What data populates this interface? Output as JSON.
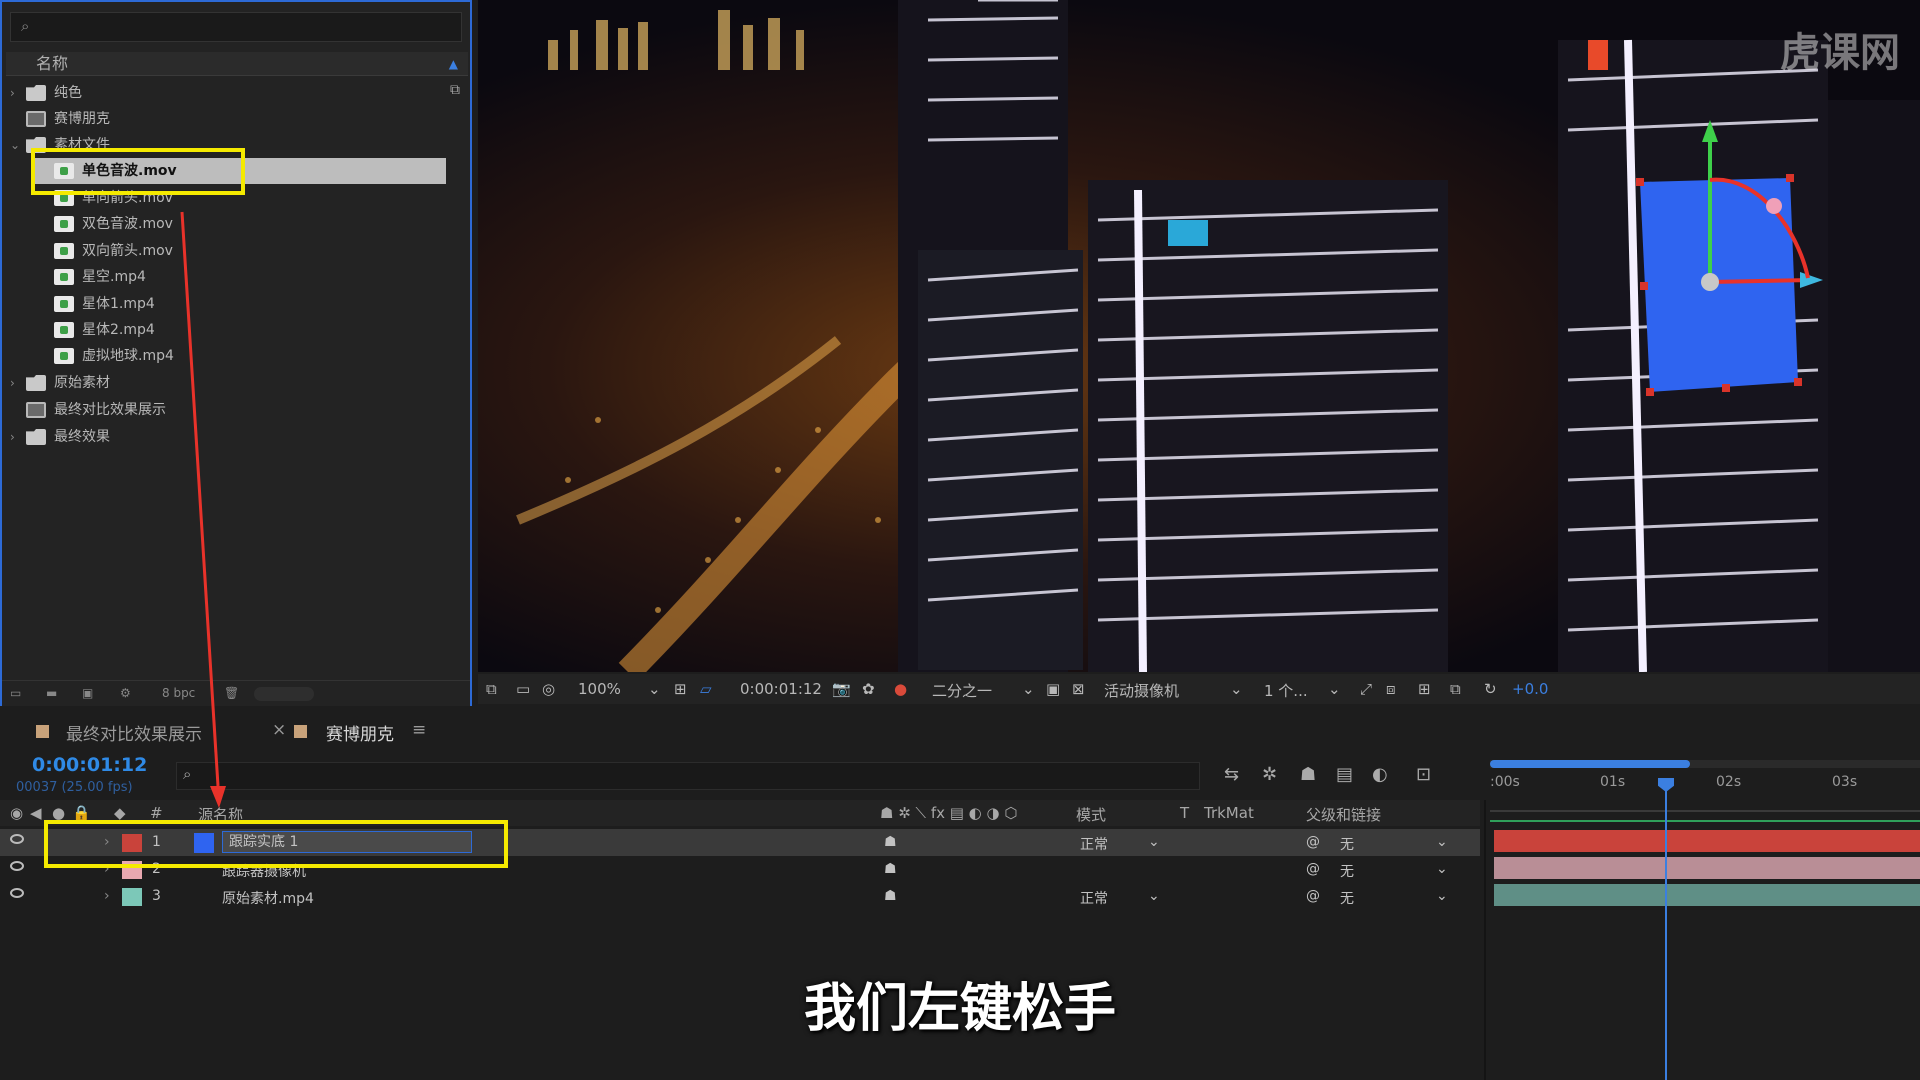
{
  "project": {
    "header_name": "名称",
    "items": [
      {
        "label": "纯色",
        "type": "folder",
        "arrow": "›"
      },
      {
        "label": "赛博朋克",
        "type": "comp",
        "arrow": ""
      },
      {
        "label": "素材文件",
        "type": "folder",
        "arrow": "⌄"
      },
      {
        "label": "单色音波.mov",
        "type": "file",
        "arrow": ""
      },
      {
        "label": "单向箭头.mov",
        "type": "file",
        "arrow": ""
      },
      {
        "label": "双色音波.mov",
        "type": "file",
        "arrow": ""
      },
      {
        "label": "双向箭头.mov",
        "type": "file",
        "arrow": ""
      },
      {
        "label": "星空.mp4",
        "type": "file",
        "arrow": ""
      },
      {
        "label": "星体1.mp4",
        "type": "file",
        "arrow": ""
      },
      {
        "label": "星体2.mp4",
        "type": "file",
        "arrow": ""
      },
      {
        "label": "虚拟地球.mp4",
        "type": "file",
        "arrow": ""
      },
      {
        "label": "原始素材",
        "type": "folder",
        "arrow": "›"
      },
      {
        "label": "最终对比效果展示",
        "type": "comp",
        "arrow": ""
      },
      {
        "label": "最终效果",
        "type": "folder",
        "arrow": "›"
      }
    ],
    "bpc": "8 bpc"
  },
  "viewer": {
    "watermark": "虎课网",
    "zoom": "100%",
    "timecode": "0:00:01:12",
    "resolution": "二分之一",
    "camera": "活动摄像机",
    "views": "1 个...",
    "exposure": "+0.0"
  },
  "timeline": {
    "tab_inactive": "最终对比效果展示",
    "tab_active": "赛博朋克",
    "tab_close": "×",
    "tab_menu": "≡",
    "timecode": "0:00:01:12",
    "frames": "00037 (25.00 fps)",
    "col_source": "源名称",
    "col_mode": "模式",
    "col_t": "T",
    "col_trkmat": "TrkMat",
    "col_parent": "父级和链接",
    "ruler": [
      ":00s",
      "01s",
      "02s",
      "03s"
    ],
    "layers": [
      {
        "num": "1",
        "name": "跟踪实底 1",
        "mode": "正常",
        "parent": "无",
        "color": "#c9433b"
      },
      {
        "num": "2",
        "name": "跟踪器摄像机",
        "mode": "",
        "parent": "无",
        "color": "#e8a8b0"
      },
      {
        "num": "3",
        "name": "原始素材.mp4",
        "mode": "正常",
        "parent": "无",
        "color": "#7cc8b8"
      }
    ]
  },
  "subtitle": "我们左键松手",
  "colors": {
    "accent": "#2d6ad6",
    "highlight": "#f5ea00",
    "arrow": "#e8322a",
    "solid": "#2f64f0"
  }
}
